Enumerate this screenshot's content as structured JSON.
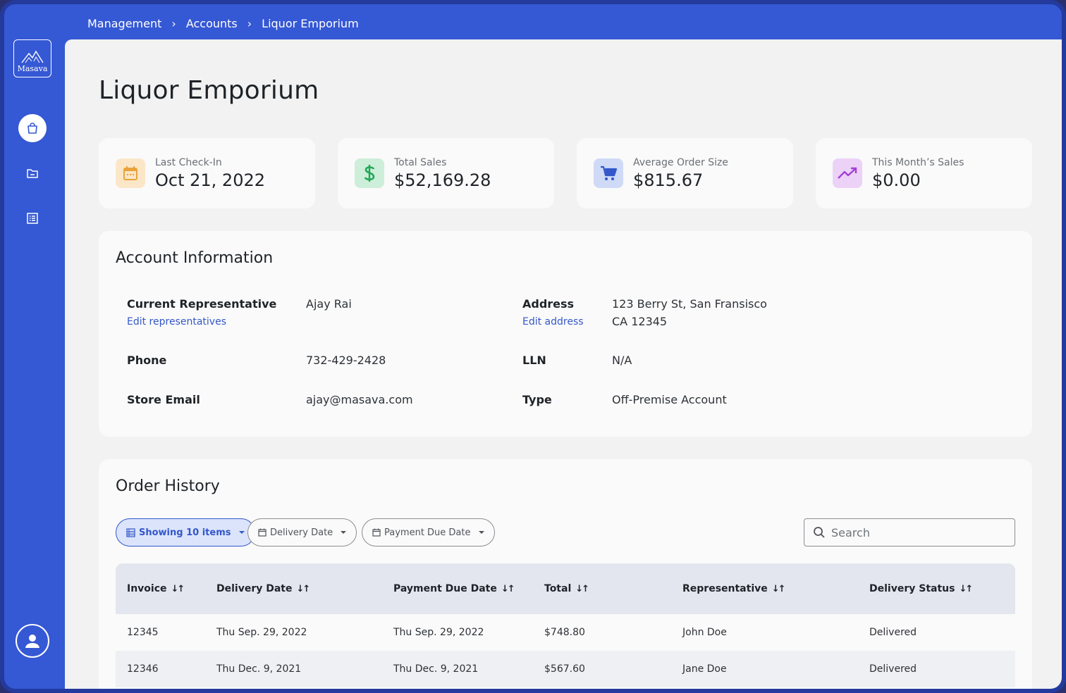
{
  "breadcrumb": [
    "Management",
    "Accounts",
    "Liquor Emporium"
  ],
  "logo": {
    "text": "Masava"
  },
  "sidebar": {
    "items": [
      {
        "icon": "shopping-bag-icon",
        "active": true
      },
      {
        "icon": "folder-icon",
        "active": false
      },
      {
        "icon": "list-icon",
        "active": false
      }
    ],
    "profile_icon": "user-icon"
  },
  "page": {
    "title": "Liquor Emporium"
  },
  "stats": [
    {
      "label": "Last Check-In",
      "value": "Oct 21, 2022",
      "icon": "calendar-icon",
      "color": "#e8a33a",
      "bg": "#fbe7c8"
    },
    {
      "label": "Total Sales",
      "value": "$52,169.28",
      "icon": "dollar-icon",
      "color": "#1fa855",
      "bg": "#cdeed9"
    },
    {
      "label": "Average Order Size",
      "value": "$815.67",
      "icon": "cart-icon",
      "color": "#3457c9",
      "bg": "#cfdaf7"
    },
    {
      "label": "This Month’s Sales",
      "value": "$0.00",
      "icon": "trending-up-icon",
      "color": "#a440d6",
      "bg": "#ecd2f7"
    }
  ],
  "account": {
    "title": "Account Information",
    "current_rep_label": "Current Representative",
    "current_rep_value": "Ajay Rai",
    "edit_reps_link": "Edit representatives",
    "phone_label": "Phone",
    "phone_value": "732-429-2428",
    "email_label": "Store Email",
    "email_value": "ajay@masava.com",
    "address_label": "Address",
    "address_line1": "123 Berry St, San Fransisco",
    "address_line2": "CA 12345",
    "edit_address_link": "Edit address",
    "lln_label": "LLN",
    "lln_value": "N/A",
    "type_label": "Type",
    "type_value": "Off-Premise Account"
  },
  "orders": {
    "title": "Order History",
    "filters": {
      "showing": "Showing 10 items",
      "delivery_date": "Delivery Date",
      "payment_due_date": "Payment Due Date"
    },
    "search_placeholder": "Search",
    "sort_glyph": "↓↑",
    "columns": [
      "Invoice",
      "Delivery Date",
      "Payment Due Date",
      "Total",
      "Representative",
      "Delivery Status"
    ],
    "rows": [
      [
        "12345",
        "Thu Sep. 29, 2022",
        "Thu Sep. 29, 2022",
        "$748.80",
        "John Doe",
        "Delivered"
      ],
      [
        "12346",
        "Thu Dec. 9, 2021",
        "Thu Dec. 9, 2021",
        "$567.60",
        "Jane Doe",
        "Delivered"
      ]
    ]
  }
}
